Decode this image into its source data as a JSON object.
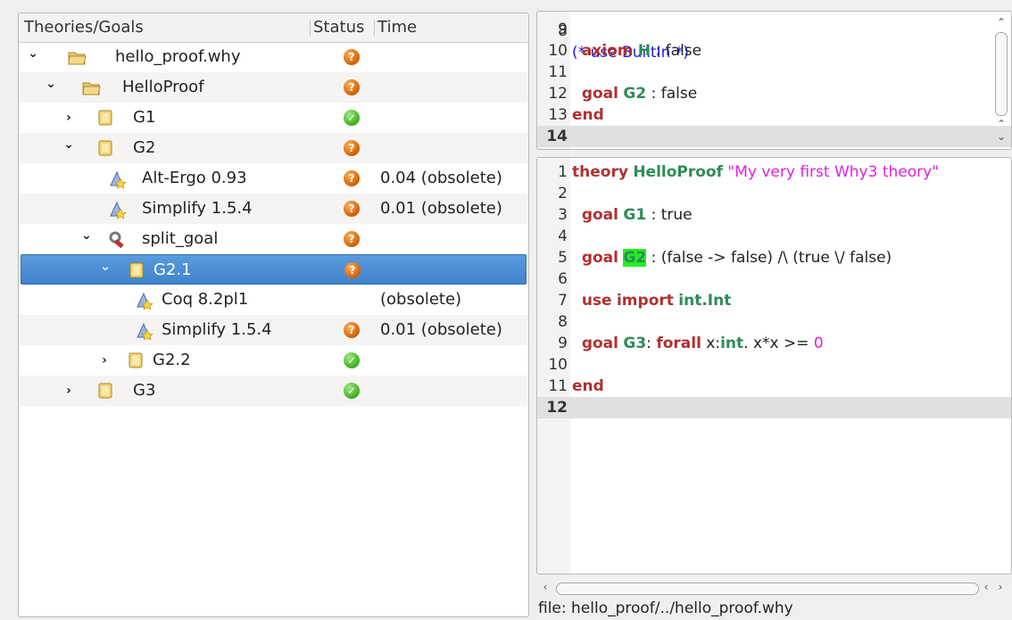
{
  "tree": {
    "columns": {
      "goals": "Theories/Goals",
      "status": "Status",
      "time": "Time"
    },
    "rows": [
      {
        "chev": "⌄",
        "icon": "folder-icon",
        "label": "hello_proof.why",
        "status": "unknown",
        "time": ""
      },
      {
        "chev": "⌄",
        "icon": "folder-icon",
        "label": "HelloProof",
        "status": "unknown",
        "time": ""
      },
      {
        "chev": "›",
        "icon": "goal-icon",
        "label": "G1",
        "status": "valid",
        "time": ""
      },
      {
        "chev": "⌄",
        "icon": "goal-icon",
        "label": "G2",
        "status": "unknown",
        "time": ""
      },
      {
        "chev": "",
        "icon": "prover-icon",
        "label": "Alt-Ergo 0.93",
        "status": "unknown",
        "time": "0.04 (obsolete)"
      },
      {
        "chev": "",
        "icon": "prover-icon",
        "label": "Simplify 1.5.4",
        "status": "unknown",
        "time": "0.01 (obsolete)"
      },
      {
        "chev": "⌄",
        "icon": "transformation-icon",
        "label": "split_goal",
        "status": "unknown",
        "time": ""
      },
      {
        "chev": "⌄",
        "icon": "goal-icon",
        "label": "G2.1",
        "status": "unknown",
        "time": ""
      },
      {
        "chev": "",
        "icon": "prover-icon",
        "label": "Coq 8.2pl1",
        "status": "",
        "time": "(obsolete)"
      },
      {
        "chev": "",
        "icon": "prover-icon",
        "label": "Simplify 1.5.4",
        "status": "unknown",
        "time": "0.01 (obsolete)"
      },
      {
        "chev": "›",
        "icon": "goal-icon",
        "label": "G2.2",
        "status": "valid",
        "time": ""
      },
      {
        "chev": "›",
        "icon": "goal-icon",
        "label": "G3",
        "status": "valid",
        "time": ""
      }
    ]
  },
  "code_top": {
    "partial_line": "(* use BuiltIn *)",
    "lines": [
      {
        "num": "9",
        "segments": []
      },
      {
        "num": "10",
        "segments": [
          {
            "t": "  "
          },
          {
            "t": "axiom",
            "c": "kw"
          },
          {
            "t": " "
          },
          {
            "t": "H",
            "c": "id"
          },
          {
            "t": " : false"
          }
        ]
      },
      {
        "num": "11",
        "segments": []
      },
      {
        "num": "12",
        "segments": [
          {
            "t": "  "
          },
          {
            "t": "goal",
            "c": "kw"
          },
          {
            "t": " "
          },
          {
            "t": "G2",
            "c": "id"
          },
          {
            "t": " : false"
          }
        ]
      },
      {
        "num": "13",
        "segments": [
          {
            "t": "end",
            "c": "kw"
          }
        ]
      },
      {
        "num": "14",
        "segments": [],
        "current": true
      }
    ]
  },
  "code_bottom": {
    "lines": [
      {
        "num": "1",
        "segments": [
          {
            "t": "theory",
            "c": "kw"
          },
          {
            "t": " "
          },
          {
            "t": "HelloProof",
            "c": "id"
          },
          {
            "t": " "
          },
          {
            "t": "\"My very first Why3 theory\"",
            "c": "str"
          }
        ]
      },
      {
        "num": "2",
        "segments": []
      },
      {
        "num": "3",
        "segments": [
          {
            "t": "  "
          },
          {
            "t": "goal",
            "c": "kw"
          },
          {
            "t": " "
          },
          {
            "t": "G1",
            "c": "id"
          },
          {
            "t": " : true"
          }
        ]
      },
      {
        "num": "4",
        "segments": []
      },
      {
        "num": "5",
        "segments": [
          {
            "t": "  "
          },
          {
            "t": "goal",
            "c": "kw"
          },
          {
            "t": " "
          },
          {
            "t": "G2",
            "c": "hl"
          },
          {
            "t": " : (false -> false) /\\ (true \\/ false)"
          }
        ]
      },
      {
        "num": "6",
        "segments": []
      },
      {
        "num": "7",
        "segments": [
          {
            "t": "  "
          },
          {
            "t": "use",
            "c": "kw"
          },
          {
            "t": " "
          },
          {
            "t": "import",
            "c": "kw"
          },
          {
            "t": " "
          },
          {
            "t": "int.Int",
            "c": "id"
          }
        ]
      },
      {
        "num": "8",
        "segments": []
      },
      {
        "num": "9",
        "segments": [
          {
            "t": "  "
          },
          {
            "t": "goal",
            "c": "kw"
          },
          {
            "t": " "
          },
          {
            "t": "G3",
            "c": "id"
          },
          {
            "t": ": "
          },
          {
            "t": "forall",
            "c": "kw"
          },
          {
            "t": " x:"
          },
          {
            "t": "int",
            "c": "id"
          },
          {
            "t": ". x*x >= "
          },
          {
            "t": "0",
            "c": "num"
          }
        ]
      },
      {
        "num": "10",
        "segments": []
      },
      {
        "num": "11",
        "segments": [
          {
            "t": "end",
            "c": "kw"
          }
        ]
      },
      {
        "num": "12",
        "segments": [],
        "current": true
      }
    ]
  },
  "statusbar": {
    "file": "file: hello_proof/../hello_proof.why"
  }
}
